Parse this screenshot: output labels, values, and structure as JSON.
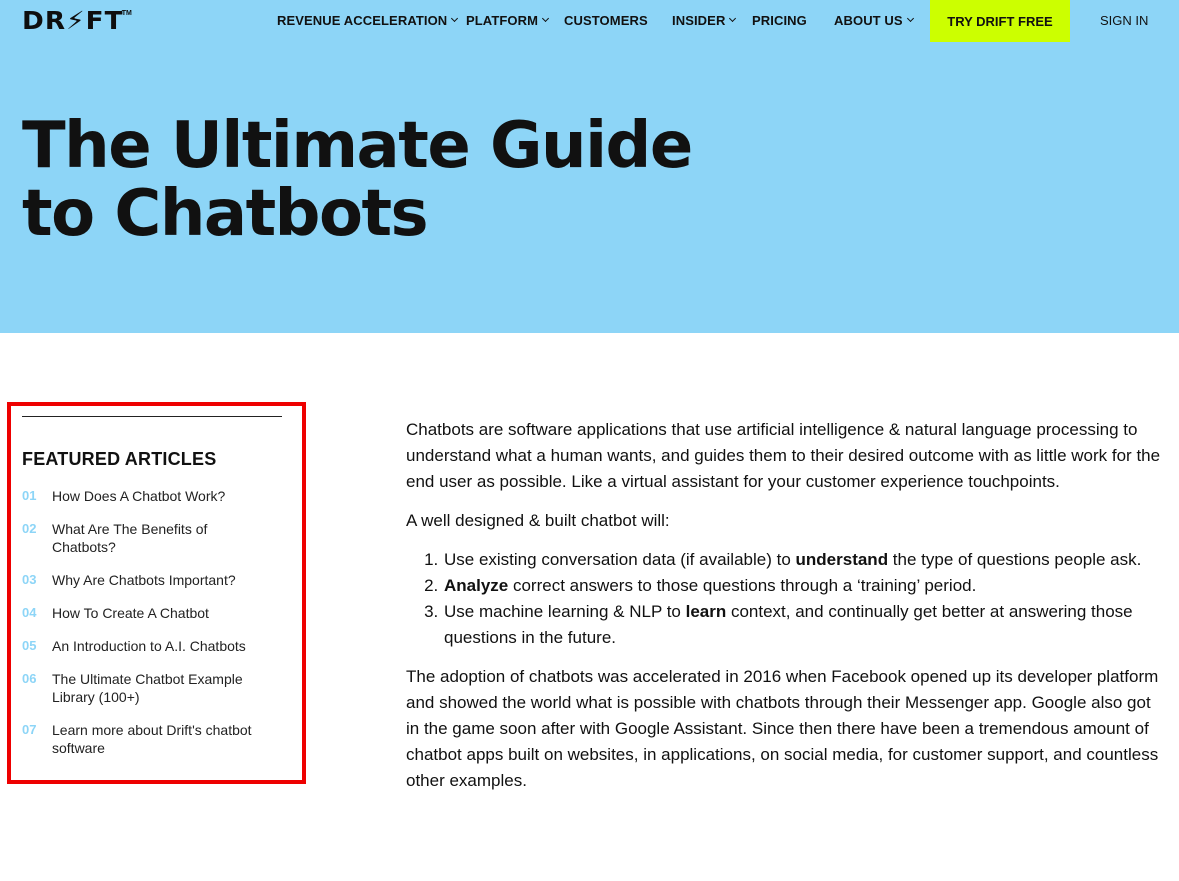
{
  "brand": {
    "logo_text": "DR⚡FT",
    "logo_tm": "TM"
  },
  "nav": {
    "items": [
      {
        "label": "REVENUE ACCELERATION",
        "has_dropdown": true
      },
      {
        "label": "PLATFORM",
        "has_dropdown": true
      },
      {
        "label": "CUSTOMERS",
        "has_dropdown": false
      },
      {
        "label": "INSIDER",
        "has_dropdown": true
      },
      {
        "label": "PRICING",
        "has_dropdown": false
      },
      {
        "label": "ABOUT US",
        "has_dropdown": true
      }
    ],
    "cta_label": "TRY DRIFT FREE",
    "signin_label": "SIGN IN"
  },
  "hero": {
    "title": "The Ultimate Guide to Chatbots"
  },
  "sidebar": {
    "heading": "FEATURED ARTICLES",
    "items": [
      {
        "num": "01",
        "label": "How Does A Chatbot Work?"
      },
      {
        "num": "02",
        "label": "What Are The Benefits of Chatbots?"
      },
      {
        "num": "03",
        "label": "Why Are Chatbots Important?"
      },
      {
        "num": "04",
        "label": "How To Create A Chatbot"
      },
      {
        "num": "05",
        "label": "An Introduction to A.I. Chatbots"
      },
      {
        "num": "06",
        "label": "The Ultimate Chatbot Example Library (100+)"
      },
      {
        "num": "07",
        "label": "Learn more about Drift's chatbot software"
      }
    ]
  },
  "article": {
    "p1": "Chatbots are software applications that use artificial intelligence & natural language processing to understand what a human wants, and guides them to their desired outcome with as little work for the end user as possible. Like a virtual assistant for your customer experience touchpoints.",
    "p2": "A well designed & built chatbot will:",
    "list": [
      {
        "pre": "Use existing conversation data (if available) to ",
        "bold": "understand",
        "post": " the type of questions people ask."
      },
      {
        "pre": "",
        "bold": "Analyze",
        "post": " correct answers to those questions through a ‘training’ period."
      },
      {
        "pre": "Use machine learning & NLP to ",
        "bold": "learn",
        "post": " context, and continually get better at answering those questions in the future."
      }
    ],
    "p3": "The adoption of chatbots was accelerated in 2016 when Facebook opened up its developer platform and showed the world what is possible with chatbots through their Messenger app. Google also got in the game soon after with Google Assistant. Since then there have been a tremendous amount of chatbot apps built on websites, in applications, on social media, for customer support, and countless other examples."
  },
  "colors": {
    "hero_bg": "#8dd5f7",
    "cta_bg": "#ccff00",
    "highlight_border": "#ee0000",
    "toc_number": "#8dd5f7"
  }
}
